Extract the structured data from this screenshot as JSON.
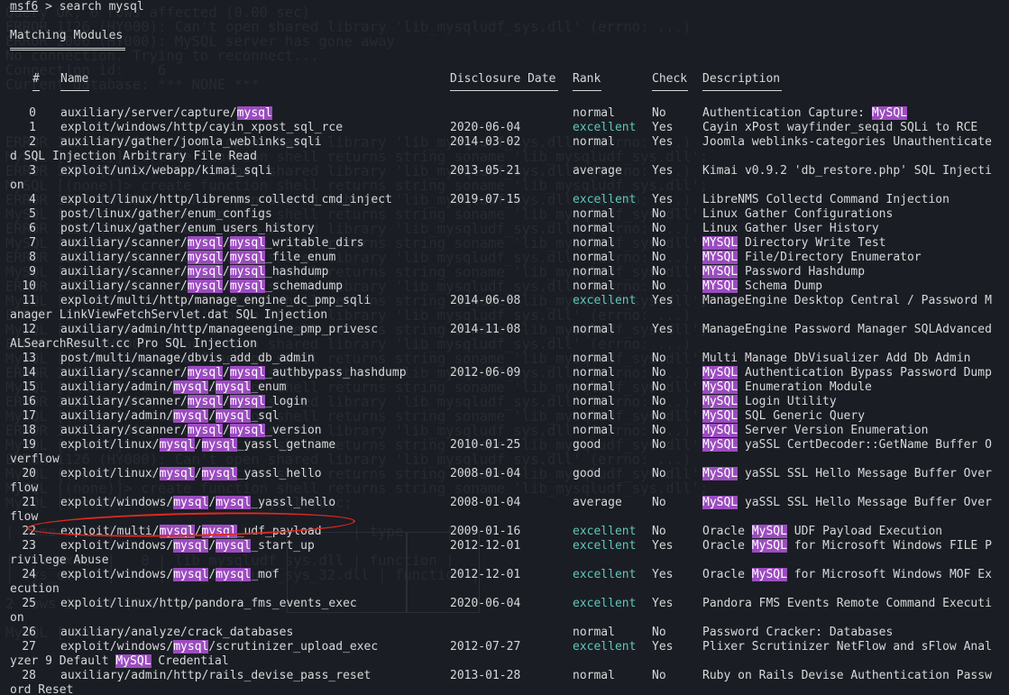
{
  "prompt": {
    "msf": "msf6",
    "command": " > search mysql"
  },
  "section_title": "Matching Modules",
  "headers": {
    "num": "#",
    "name": "Name",
    "date": "Disclosure Date",
    "rank": "Rank",
    "check": "Check",
    "desc": "Description"
  },
  "ghost_lines": [
    "Query OK, 0 rows affected (0.00 sec)",
    "ERROR 1126 (HY000): Can't open shared library 'lib_mysqludf_sys.dll' (errno: ...)",
    "ERROR 2006 (HY000): MySQL server has gone away",
    "No connection. Trying to reconnect...",
    "Connection id:    6",
    "Current database: *** NONE ***",
    "",
    "",
    "",
    "ERROR 1126 (HY000): Can't open shared library 'lib_mysqludf_sys.dll' (errno: ...)",
    "MySQL [(none)]> create function shell returns string soname 'lib_mysqludf_sys.dll';",
    "ERROR 1126 (HY000): Can't open shared library 'lib_mysqludf_sys.dll' (errno: ...)",
    "MySQL [(none)]> create function shell returns string soname 'lib_mysqludf_sys.dll';",
    "ERROR 1126 (HY000): Can't open shared library 'lib_mysqludf_sys.dll' (errno: ...)",
    "MySQL [(none)]> create function shell returns string soname 'lib_mysqludf_sys.dll';",
    "ERROR 1126 (HY000): Can't open shared library 'lib_mysqludf_sys.dll' (errno: ...)",
    "MySQL [(none)]> create function shell returns string soname 'lib_mysqludf_sys.dll';",
    "ERROR 1126 (HY000): Can't open shared library 'lib_mysqludf_sys.dll' (errno: ...)",
    "MySQL [(none)]> create function shell returns string soname 'lib_mysqludf_sys.dll';",
    "ERROR 1126 (HY000): Can't open shared library 'lib_mysqludf_sys.dll' (errno: ...)",
    "MySQL [(none)]> create function shell returns string soname 'lib_mysqludf_sys.dll';",
    "ERROR 1126 (HY000): Can't open shared library 'lib_mysqludf_sys.dll' (errno: ...)",
    "MySQL [(none)]> create function shell returns string soname 'lib_mysqludf_sys.dll';",
    "ERROR 1126 (HY000): Can't open shared library 'lib_mysqludf_sys.dll' (errno: ...)",
    "MySQL [(none)]> create function shell returns string soname 'lib_mysqludf_sys.dll';",
    "ERROR 1126 (HY000): Can't open shared library 'lib_mysqludf_sys.dll' (errno: ...)",
    "MySQL [(none)]> create function shell returns string soname 'lib_mysqludf_sys.dll';",
    "ERROR 1126 (HY000): Can't open shared library 'lib_mysqludf_sys.dll' (errno: ...)",
    "MySQL [(none)]> create function shell returns string soname 'lib_mysqludf_sys.dll';",
    "ERROR 1126 (HY000): Can't open shared library 'lib_mysqludf_sys.dll' (errno: ...)",
    "MySQL [(none)]> create function shell returns string soname 'lib_mysqludf_sys.dll';",
    "ERROR 1126 (HY000): Can't open shared library 'lib_mysqludf_sys.dll' (errno: ...)",
    "MySQL [(none)]> create function shell returns string soname 'lib_mysqludf_sys.dll';",
    "MySQL [(none)]> create function shell returns string soname 'lib_mysqludf_sys.dll';",
    "MySQL [(none)]> select * from mysql.func;",
    "",
    "| name      | ret | dl                   | type     |",
    "",
    "| sys_exec  |   0 | lib_mysqludf_sys.dll | function |",
    "| sys_eval  |   0 | lib_mysqludf_sys_32.dll | function |",
    "",
    "2 rows in set (0.00 sec)",
    "",
    "MySQL [(none)]> "
  ],
  "modules": [
    {
      "num": "0",
      "name": [
        {
          "t": "auxiliary/server/capture/"
        },
        {
          "t": "mysql",
          "h": true
        }
      ],
      "date": "",
      "rank": "normal",
      "check": "No",
      "desc": [
        {
          "t": "Authentication Capture: "
        },
        {
          "t": "MySQL",
          "h": true
        }
      ],
      "wrap": ""
    },
    {
      "num": "1",
      "name": [
        {
          "t": "exploit/windows/http/cayin_xpost_sql_rce"
        }
      ],
      "date": "2020-06-04",
      "rank": "excellent",
      "check": "Yes",
      "desc": [
        {
          "t": "Cayin xPost wayfinder_seqid SQLi to RCE"
        }
      ],
      "wrap": ""
    },
    {
      "num": "2",
      "name": [
        {
          "t": "auxiliary/gather/joomla_weblinks_sqli"
        }
      ],
      "date": "2014-03-02",
      "rank": "normal",
      "check": "Yes",
      "desc": [
        {
          "t": "Joomla weblinks-categories Unauthenticate"
        }
      ],
      "wrap": "d SQL Injection Arbitrary File Read"
    },
    {
      "num": "3",
      "name": [
        {
          "t": "exploit/unix/webapp/kimai_sqli"
        }
      ],
      "date": "2013-05-21",
      "rank": "average",
      "check": "Yes",
      "desc": [
        {
          "t": "Kimai v0.9.2 'db_restore.php' SQL Injecti"
        }
      ],
      "wrap": "on"
    },
    {
      "num": "4",
      "name": [
        {
          "t": "exploit/linux/http/librenms_collectd_cmd_inject"
        }
      ],
      "date": "2019-07-15",
      "rank": "excellent",
      "check": "Yes",
      "desc": [
        {
          "t": "LibreNMS Collectd Command Injection"
        }
      ],
      "wrap": ""
    },
    {
      "num": "5",
      "name": [
        {
          "t": "post/linux/gather/enum_configs"
        }
      ],
      "date": "",
      "rank": "normal",
      "check": "No",
      "desc": [
        {
          "t": "Linux Gather Configurations"
        }
      ],
      "wrap": ""
    },
    {
      "num": "6",
      "name": [
        {
          "t": "post/linux/gather/enum_users_history"
        }
      ],
      "date": "",
      "rank": "normal",
      "check": "No",
      "desc": [
        {
          "t": "Linux Gather User History"
        }
      ],
      "wrap": ""
    },
    {
      "num": "7",
      "name": [
        {
          "t": "auxiliary/scanner/"
        },
        {
          "t": "mysql",
          "h": true
        },
        {
          "t": "/"
        },
        {
          "t": "mysql",
          "h": true
        },
        {
          "t": "_writable_dirs"
        }
      ],
      "date": "",
      "rank": "normal",
      "check": "No",
      "desc": [
        {
          "t": "MYSQL",
          "h": true
        },
        {
          "t": " Directory Write Test"
        }
      ],
      "wrap": ""
    },
    {
      "num": "8",
      "name": [
        {
          "t": "auxiliary/scanner/"
        },
        {
          "t": "mysql",
          "h": true
        },
        {
          "t": "/"
        },
        {
          "t": "mysql",
          "h": true
        },
        {
          "t": "_file_enum"
        }
      ],
      "date": "",
      "rank": "normal",
      "check": "No",
      "desc": [
        {
          "t": "MYSQL",
          "h": true
        },
        {
          "t": " File/Directory Enumerator"
        }
      ],
      "wrap": ""
    },
    {
      "num": "9",
      "name": [
        {
          "t": "auxiliary/scanner/"
        },
        {
          "t": "mysql",
          "h": true
        },
        {
          "t": "/"
        },
        {
          "t": "mysql",
          "h": true
        },
        {
          "t": "_hashdump"
        }
      ],
      "date": "",
      "rank": "normal",
      "check": "No",
      "desc": [
        {
          "t": "MYSQL",
          "h": true
        },
        {
          "t": " Password Hashdump"
        }
      ],
      "wrap": ""
    },
    {
      "num": "10",
      "name": [
        {
          "t": "auxiliary/scanner/"
        },
        {
          "t": "mysql",
          "h": true
        },
        {
          "t": "/"
        },
        {
          "t": "mysql",
          "h": true
        },
        {
          "t": "_schemadump"
        }
      ],
      "date": "",
      "rank": "normal",
      "check": "No",
      "desc": [
        {
          "t": "MYSQL",
          "h": true
        },
        {
          "t": " Schema Dump"
        }
      ],
      "wrap": ""
    },
    {
      "num": "11",
      "name": [
        {
          "t": "exploit/multi/http/manage_engine_dc_pmp_sqli"
        }
      ],
      "date": "2014-06-08",
      "rank": "excellent",
      "check": "Yes",
      "desc": [
        {
          "t": "ManageEngine Desktop Central / Password M"
        }
      ],
      "wrap": "anager LinkViewFetchServlet.dat SQL Injection"
    },
    {
      "num": "12",
      "name": [
        {
          "t": "auxiliary/admin/http/manageengine_pmp_privesc"
        }
      ],
      "date": "2014-11-08",
      "rank": "normal",
      "check": "Yes",
      "desc": [
        {
          "t": "ManageEngine Password Manager SQLAdvanced"
        }
      ],
      "wrap": "ALSearchResult.cc Pro SQL Injection"
    },
    {
      "num": "13",
      "name": [
        {
          "t": "post/multi/manage/dbvis_add_db_admin"
        }
      ],
      "date": "",
      "rank": "normal",
      "check": "No",
      "desc": [
        {
          "t": "Multi Manage DbVisualizer Add Db Admin"
        }
      ],
      "wrap": ""
    },
    {
      "num": "14",
      "name": [
        {
          "t": "auxiliary/scanner/"
        },
        {
          "t": "mysql",
          "h": true
        },
        {
          "t": "/"
        },
        {
          "t": "mysql",
          "h": true
        },
        {
          "t": "_authbypass_hashdump"
        }
      ],
      "date": "2012-06-09",
      "rank": "normal",
      "check": "No",
      "desc": [
        {
          "t": "MySQL",
          "h": true
        },
        {
          "t": " Authentication Bypass Password Dump"
        }
      ],
      "wrap": ""
    },
    {
      "num": "15",
      "name": [
        {
          "t": "auxiliary/admin/"
        },
        {
          "t": "mysql",
          "h": true
        },
        {
          "t": "/"
        },
        {
          "t": "mysql",
          "h": true
        },
        {
          "t": "_enum"
        }
      ],
      "date": "",
      "rank": "normal",
      "check": "No",
      "desc": [
        {
          "t": "MySQL",
          "h": true
        },
        {
          "t": " Enumeration Module"
        }
      ],
      "wrap": ""
    },
    {
      "num": "16",
      "name": [
        {
          "t": "auxiliary/scanner/"
        },
        {
          "t": "mysql",
          "h": true
        },
        {
          "t": "/"
        },
        {
          "t": "mysql",
          "h": true
        },
        {
          "t": "_login"
        }
      ],
      "date": "",
      "rank": "normal",
      "check": "No",
      "desc": [
        {
          "t": "MySQL",
          "h": true
        },
        {
          "t": " Login Utility"
        }
      ],
      "wrap": ""
    },
    {
      "num": "17",
      "name": [
        {
          "t": "auxiliary/admin/"
        },
        {
          "t": "mysql",
          "h": true
        },
        {
          "t": "/"
        },
        {
          "t": "mysql",
          "h": true
        },
        {
          "t": "_sql"
        }
      ],
      "date": "",
      "rank": "normal",
      "check": "No",
      "desc": [
        {
          "t": "MySQL",
          "h": true
        },
        {
          "t": " SQL Generic Query"
        }
      ],
      "wrap": ""
    },
    {
      "num": "18",
      "name": [
        {
          "t": "auxiliary/scanner/"
        },
        {
          "t": "mysql",
          "h": true
        },
        {
          "t": "/"
        },
        {
          "t": "mysql",
          "h": true
        },
        {
          "t": "_version"
        }
      ],
      "date": "",
      "rank": "normal",
      "check": "No",
      "desc": [
        {
          "t": "MySQL",
          "h": true
        },
        {
          "t": " Server Version Enumeration"
        }
      ],
      "wrap": ""
    },
    {
      "num": "19",
      "name": [
        {
          "t": "exploit/linux/"
        },
        {
          "t": "mysql",
          "h": true
        },
        {
          "t": "/"
        },
        {
          "t": "mysql",
          "h": true
        },
        {
          "t": "_yassl_getname"
        }
      ],
      "date": "2010-01-25",
      "rank": "good",
      "check": "No",
      "desc": [
        {
          "t": "MySQL",
          "h": true
        },
        {
          "t": " yaSSL CertDecoder::GetName Buffer O"
        }
      ],
      "wrap": "verflow"
    },
    {
      "num": "20",
      "name": [
        {
          "t": "exploit/linux/"
        },
        {
          "t": "mysql",
          "h": true
        },
        {
          "t": "/"
        },
        {
          "t": "mysql",
          "h": true
        },
        {
          "t": "_yassl_hello"
        }
      ],
      "date": "2008-01-04",
      "rank": "good",
      "check": "No",
      "desc": [
        {
          "t": "MySQL",
          "h": true
        },
        {
          "t": " yaSSL SSL Hello Message Buffer Over"
        }
      ],
      "wrap": "flow"
    },
    {
      "num": "21",
      "name": [
        {
          "t": "exploit/windows/"
        },
        {
          "t": "mysql",
          "h": true
        },
        {
          "t": "/"
        },
        {
          "t": "mysql",
          "h": true
        },
        {
          "t": "_yassl_hello"
        }
      ],
      "date": "2008-01-04",
      "rank": "average",
      "check": "No",
      "desc": [
        {
          "t": "MySQL",
          "h": true
        },
        {
          "t": " yaSSL SSL Hello Message Buffer Over"
        }
      ],
      "wrap": "flow"
    },
    {
      "num": "22",
      "name": [
        {
          "t": "exploit/multi/"
        },
        {
          "t": "mysql",
          "h": true
        },
        {
          "t": "/"
        },
        {
          "t": "mysql",
          "h": true
        },
        {
          "t": "_udf_payload"
        }
      ],
      "date": "2009-01-16",
      "rank": "excellent",
      "check": "No",
      "desc": [
        {
          "t": "Oracle "
        },
        {
          "t": "MySQL",
          "h": true
        },
        {
          "t": " UDF Payload Execution"
        }
      ],
      "wrap": ""
    },
    {
      "num": "23",
      "name": [
        {
          "t": "exploit/windows/"
        },
        {
          "t": "mysql",
          "h": true
        },
        {
          "t": "/"
        },
        {
          "t": "mysql",
          "h": true
        },
        {
          "t": "_start_up"
        }
      ],
      "date": "2012-12-01",
      "rank": "excellent",
      "check": "Yes",
      "desc": [
        {
          "t": "Oracle "
        },
        {
          "t": "MySQL",
          "h": true
        },
        {
          "t": " for Microsoft Windows FILE P"
        }
      ],
      "wrap": "rivilege Abuse"
    },
    {
      "num": "24",
      "name": [
        {
          "t": "exploit/windows/"
        },
        {
          "t": "mysql",
          "h": true
        },
        {
          "t": "/"
        },
        {
          "t": "mysql",
          "h": true
        },
        {
          "t": "_mof"
        }
      ],
      "date": "2012-12-01",
      "rank": "excellent",
      "check": "Yes",
      "desc": [
        {
          "t": "Oracle "
        },
        {
          "t": "MySQL",
          "h": true
        },
        {
          "t": " for Microsoft Windows MOF Ex"
        }
      ],
      "wrap": "ecution"
    },
    {
      "num": "25",
      "name": [
        {
          "t": "exploit/linux/http/pandora_fms_events_exec"
        }
      ],
      "date": "2020-06-04",
      "rank": "excellent",
      "check": "Yes",
      "desc": [
        {
          "t": "Pandora FMS Events Remote Command Executi"
        }
      ],
      "wrap": "on"
    },
    {
      "num": "26",
      "name": [
        {
          "t": "auxiliary/analyze/crack_databases"
        }
      ],
      "date": "",
      "rank": "normal",
      "check": "No",
      "desc": [
        {
          "t": "Password Cracker: Databases"
        }
      ],
      "wrap": ""
    },
    {
      "num": "27",
      "name": [
        {
          "t": "exploit/windows/"
        },
        {
          "t": "mysql",
          "h": true
        },
        {
          "t": "/scrutinizer_upload_exec"
        }
      ],
      "date": "2012-07-27",
      "rank": "excellent",
      "check": "Yes",
      "desc": [
        {
          "t": "Plixer Scrutinizer NetFlow and sFlow Anal"
        }
      ],
      "wrap": [
        {
          "t": "yzer 9 Default "
        },
        {
          "t": "MySQL",
          "h": true
        },
        {
          "t": " Credential"
        }
      ]
    },
    {
      "num": "28",
      "name": [
        {
          "t": "auxiliary/admin/http/rails_devise_pass_reset"
        }
      ],
      "date": "2013-01-28",
      "rank": "normal",
      "check": "No",
      "desc": [
        {
          "t": "Ruby on Rails Devise Authentication Passw"
        }
      ],
      "wrap": "ord Reset"
    }
  ],
  "colors": {
    "background": "#1a1d24",
    "text": "#d8d8d8",
    "excellent": "#5fc8b8",
    "highlight": "#9b4cbf",
    "annotation": "#e0281f"
  }
}
